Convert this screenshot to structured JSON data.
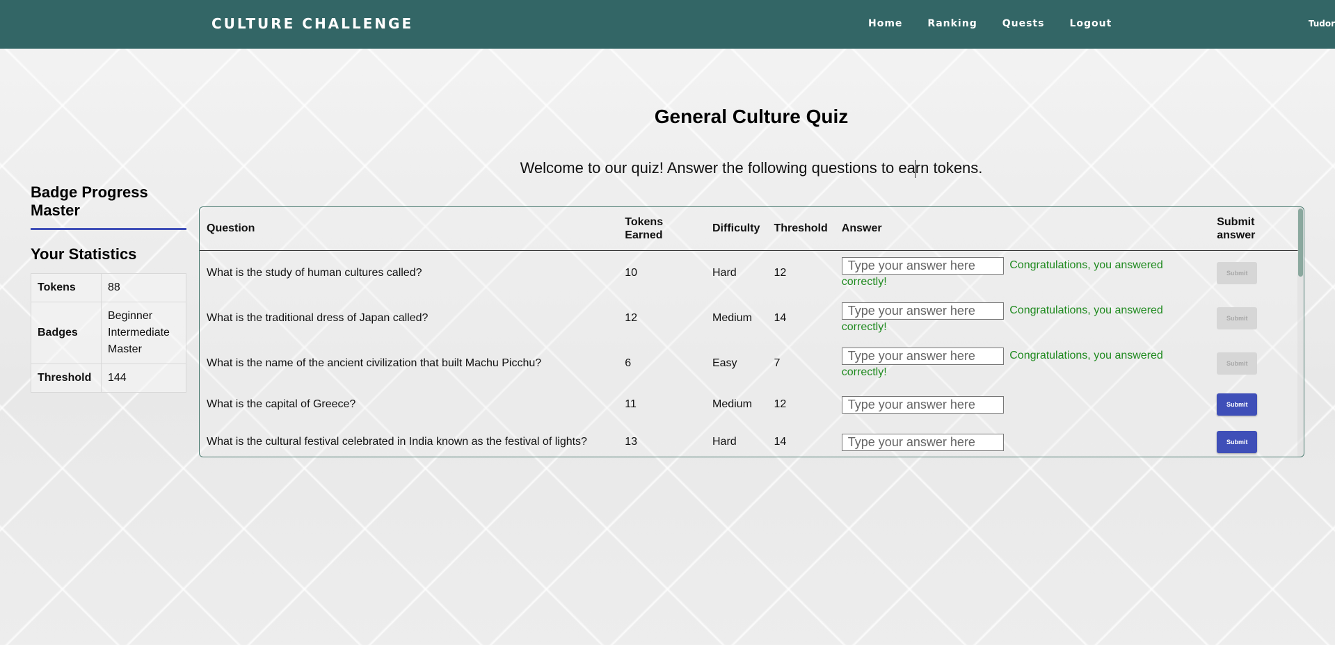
{
  "navbar": {
    "brand": "CULTURE CHALLENGE",
    "links": [
      "Home",
      "Ranking",
      "Quests",
      "Logout"
    ],
    "user": "Tudor"
  },
  "sidebar": {
    "badge_title": "Badge Progress Master",
    "stats_title": "Your Statistics",
    "stats": {
      "tokens_label": "Tokens",
      "tokens_value": "88",
      "badges_label": "Badges",
      "badges_values": [
        "Beginner",
        "Intermediate",
        "Master"
      ],
      "threshold_label": "Threshold",
      "threshold_value": "144"
    }
  },
  "quiz": {
    "title": "General Culture Quiz",
    "intro": "Welcome to our quiz! Answer the following questions to earn tokens.",
    "headers": [
      "Question",
      "Tokens Earned",
      "Difficulty",
      "Threshold",
      "Answer",
      "Submit answer"
    ],
    "answer_placeholder": "Type your answer here",
    "success_message": "Congratulations, you answered correctly!",
    "submit_label": "Submit",
    "rows": [
      {
        "question": "What is the study of human cultures called?",
        "tokens": "10",
        "difficulty": "Hard",
        "threshold": "12",
        "answered": true
      },
      {
        "question": "What is the traditional dress of Japan called?",
        "tokens": "12",
        "difficulty": "Medium",
        "threshold": "14",
        "answered": true
      },
      {
        "question": "What is the name of the ancient civilization that built Machu Picchu?",
        "tokens": "6",
        "difficulty": "Easy",
        "threshold": "7",
        "answered": true
      },
      {
        "question": "What is the capital of Greece?",
        "tokens": "11",
        "difficulty": "Medium",
        "threshold": "12",
        "answered": false
      },
      {
        "question": "What is the cultural festival celebrated in India known as the festival of lights?",
        "tokens": "13",
        "difficulty": "Hard",
        "threshold": "14",
        "answered": false
      }
    ]
  },
  "colors": {
    "navbar": "#336666",
    "accent": "#3f4fb8",
    "success": "#1f8a1f"
  }
}
